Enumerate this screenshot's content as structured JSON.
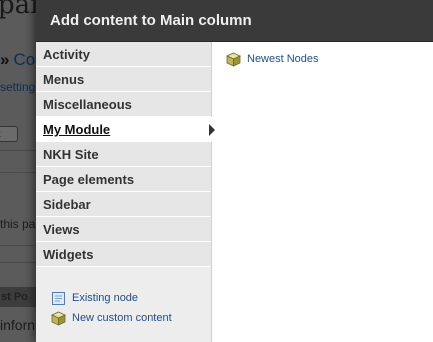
{
  "background": {
    "heading": "panels_layout_default",
    "breadcrumb_arrow": "»",
    "breadcrumb_text": "Co",
    "settings_text": "setting",
    "select_text": "t",
    "this_text": "this pa",
    "bar_text": "st Po",
    "info_text": "inforn"
  },
  "modal": {
    "title": "Add content to Main column",
    "categories": [
      {
        "label": "Activity"
      },
      {
        "label": "Menus"
      },
      {
        "label": "Miscellaneous"
      },
      {
        "label": "My Module",
        "active": true
      },
      {
        "label": "NKH Site"
      },
      {
        "label": "Page elements"
      },
      {
        "label": "Sidebar"
      },
      {
        "label": "Views"
      },
      {
        "label": "Widgets"
      }
    ],
    "side_links": [
      {
        "label": "Existing node",
        "icon": "document-icon"
      },
      {
        "label": "New custom content",
        "icon": "cube-icon"
      }
    ],
    "content_items": [
      {
        "label": "Newest Nodes",
        "icon": "cube-icon"
      }
    ]
  },
  "colors": {
    "header_bg": "#3a3a3a",
    "link": "#20508c",
    "sidebar_bg": "#ededed"
  }
}
